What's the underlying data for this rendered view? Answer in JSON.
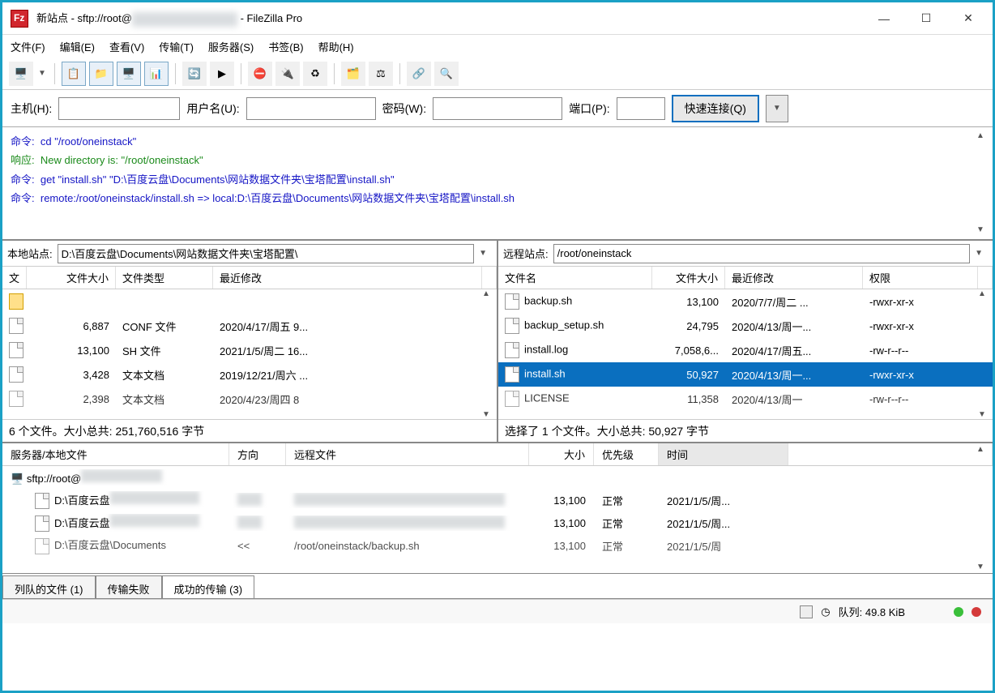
{
  "title": {
    "prefix": "新站点 - sftp://root@",
    "suffix": " - FileZilla Pro"
  },
  "menu": [
    "文件(F)",
    "编辑(E)",
    "查看(V)",
    "传输(T)",
    "服务器(S)",
    "书签(B)",
    "帮助(H)"
  ],
  "quick": {
    "host": "主机(H):",
    "user": "用户名(U):",
    "pass": "密码(W):",
    "port": "端口(P):",
    "connect": "快速连接(Q)"
  },
  "log": [
    {
      "t": "cmd",
      "label": "命令:",
      "text": "cd \"/root/oneinstack\""
    },
    {
      "t": "ok",
      "label": "响应:",
      "text": "New directory is: \"/root/oneinstack\""
    },
    {
      "t": "cmd",
      "label": "命令:",
      "text": "get \"install.sh\" \"D:\\百度云盘\\Documents\\网站数据文件夹\\宝塔配置\\install.sh\""
    },
    {
      "t": "cmd",
      "label": "命令:",
      "text": "remote:/root/oneinstack/install.sh => local:D:\\百度云盘\\Documents\\网站数据文件夹\\宝塔配置\\install.sh"
    }
  ],
  "local": {
    "label": "本地站点:",
    "path": "D:\\百度云盘\\Documents\\网站数据文件夹\\宝塔配置\\",
    "cols": {
      "name": "文",
      "size": "文件大小",
      "type": "文件类型",
      "mod": "最近修改"
    },
    "rows": [
      {
        "icon": "folder",
        "size": "",
        "type": "",
        "mod": ""
      },
      {
        "icon": "file",
        "size": "6,887",
        "type": "CONF 文件",
        "mod": "2020/4/17/周五 9..."
      },
      {
        "icon": "file",
        "size": "13,100",
        "type": "SH 文件",
        "mod": "2021/1/5/周二 16..."
      },
      {
        "icon": "file",
        "size": "3,428",
        "type": "文本文档",
        "mod": "2019/12/21/周六 ..."
      },
      {
        "icon": "file",
        "size": "2,398",
        "type": "文本文档",
        "mod": "2020/4/23/周四 8"
      }
    ],
    "status": "6 个文件。大小总共: 251,760,516 字节"
  },
  "remote": {
    "label": "远程站点:",
    "path": "/root/oneinstack",
    "cols": {
      "name": "文件名",
      "size": "文件大小",
      "mod": "最近修改",
      "perm": "权限"
    },
    "rows": [
      {
        "name": "backup.sh",
        "size": "13,100",
        "mod": "2020/7/7/周二 ...",
        "perm": "-rwxr-xr-x"
      },
      {
        "name": "backup_setup.sh",
        "size": "24,795",
        "mod": "2020/4/13/周一...",
        "perm": "-rwxr-xr-x"
      },
      {
        "name": "install.log",
        "size": "7,058,6...",
        "mod": "2020/4/17/周五...",
        "perm": "-rw-r--r--"
      },
      {
        "name": "install.sh",
        "size": "50,927",
        "mod": "2020/4/13/周一...",
        "perm": "-rwxr-xr-x",
        "sel": true
      },
      {
        "name": "LICENSE",
        "size": "11,358",
        "mod": "2020/4/13/周一",
        "perm": "-rw-r--r--"
      }
    ],
    "status": "选择了 1 个文件。大小总共: 50,927 字节"
  },
  "queue": {
    "cols": {
      "server": "服务器/本地文件",
      "dir": "方向",
      "remote": "远程文件",
      "size": "大小",
      "prio": "优先级",
      "time": "时间"
    },
    "server": "sftp://root@",
    "rows": [
      {
        "local": "D:\\百度云盘",
        "size": "13,100",
        "prio": "正常",
        "time": "2021/1/5/周..."
      },
      {
        "local": "D:\\百度云盘",
        "size": "13,100",
        "prio": "正常",
        "time": "2021/1/5/周..."
      },
      {
        "local": "D:\\百度云盘\\Documents",
        "remote": "/root/oneinstack/backup.sh",
        "size": "13,100",
        "prio": "正常",
        "time": "2021/1/5/周"
      }
    ]
  },
  "tabs": [
    "列队的文件 (1)",
    "传输失败",
    "成功的传输  (3)"
  ],
  "status": {
    "queue": "队列: 49.8 KiB"
  }
}
